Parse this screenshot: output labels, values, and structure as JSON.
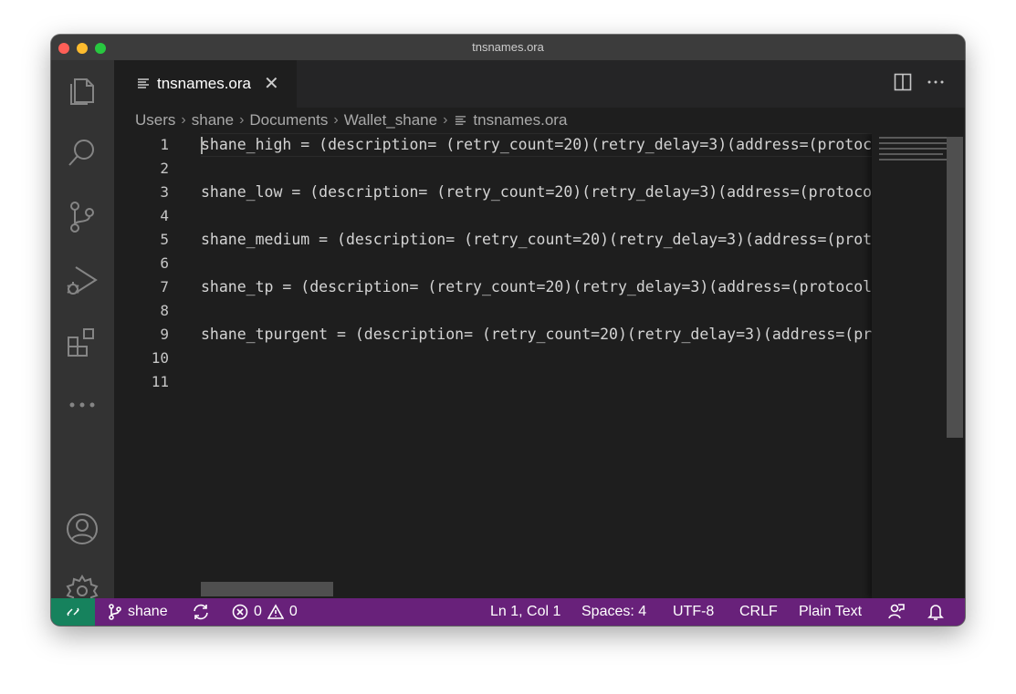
{
  "window": {
    "title": "tnsnames.ora"
  },
  "activity_bar": {
    "icons": [
      "files-icon",
      "search-icon",
      "source-control-icon",
      "run-debug-icon",
      "extensions-icon",
      "more-icon",
      "account-icon",
      "settings-gear-icon"
    ]
  },
  "tabs": [
    {
      "label": "tnsnames.ora",
      "icon": "file-lines-icon",
      "active": true
    }
  ],
  "tab_actions": [
    "split-editor-icon",
    "more-actions-icon"
  ],
  "breadcrumb": {
    "items": [
      "Users",
      "shane",
      "Documents",
      "Wallet_shane",
      "tnsnames.ora"
    ]
  },
  "editor": {
    "lines": [
      {
        "num": "1",
        "text": "shane_high = (description= (retry_count=20)(retry_delay=3)(address=(protocol=tcps)(port=1522)(host=adb.us-ashburn-1.oraclecloud.com))(connect_data=(service_name=shane_high.adb.oraclecloud.com))(security=(ssl_server_cert_dn=\"CN=adb.us-ashburn-1.oraclecloud.com\")))"
      },
      {
        "num": "2",
        "text": ""
      },
      {
        "num": "3",
        "text": "shane_low = (description= (retry_count=20)(retry_delay=3)(address=(protocol=tcps)(port=1522)(host=adb.us-ashburn-1.oraclecloud.com))(connect_data=(service_name=shane_low.adb.oraclecloud.com))(security=(ssl_server_cert_dn=\"CN=adb.us-ashburn-1.oraclecloud.com\")))"
      },
      {
        "num": "4",
        "text": ""
      },
      {
        "num": "5",
        "text": "shane_medium = (description= (retry_count=20)(retry_delay=3)(address=(protocol=tcps)(port=1522)(host=adb.us-ashburn-1.oraclecloud.com))(connect_data=(service_name=shane_medium.adb.oraclecloud.com))(security=(ssl_server_cert_dn=\"CN=adb.us-ashburn-1.oraclecloud.com\")))"
      },
      {
        "num": "6",
        "text": ""
      },
      {
        "num": "7",
        "text": "shane_tp = (description= (retry_count=20)(retry_delay=3)(address=(protocol=tcps)(port=1522)(host=adb.us-ashburn-1.oraclecloud.com))(connect_data=(service_name=shane_tp.adb.oraclecloud.com))(security=(ssl_server_cert_dn=\"CN=adb.us-ashburn-1.oraclecloud.com\")))"
      },
      {
        "num": "8",
        "text": ""
      },
      {
        "num": "9",
        "text": "shane_tpurgent = (description= (retry_count=20)(retry_delay=3)(address=(protocol=tcps)(port=1522)(host=adb.us-ashburn-1.oraclecloud.com))(connect_data=(service_name=shane_tpurgent.adb.oraclecloud.com))(security=(ssl_server_cert_dn=\"CN=adb.us-ashburn-1.oraclecloud.com\")))"
      },
      {
        "num": "10",
        "text": ""
      },
      {
        "num": "11",
        "text": ""
      }
    ]
  },
  "status_bar": {
    "remote_icon": "remote-icon",
    "branch": "shane",
    "sync_icon": "sync-icon",
    "errors": "0",
    "warnings": "0",
    "cursor_position": "Ln 1, Col 1",
    "indentation": "Spaces: 4",
    "encoding": "UTF-8",
    "line_ending": "CRLF",
    "language": "Plain Text",
    "feedback_icon": "feedback-icon",
    "notifications_icon": "bell-icon"
  },
  "colors": {
    "status_bar": "#68217a",
    "remote": "#16825d",
    "editor_bg": "#1e1e1e",
    "activity_bar": "#333333"
  }
}
